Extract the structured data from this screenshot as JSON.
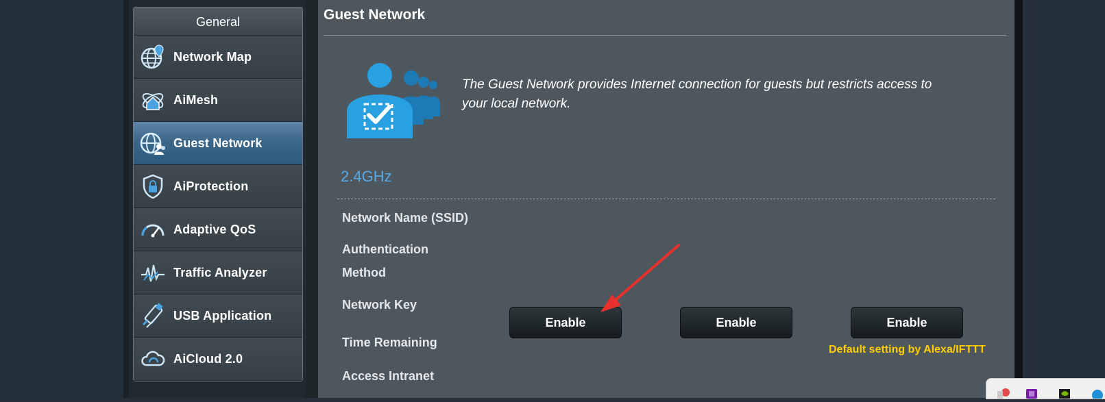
{
  "sidebar": {
    "header": "General",
    "items": [
      {
        "label": "Network Map",
        "icon": "network-map-icon",
        "active": false
      },
      {
        "label": "AiMesh",
        "icon": "aimesh-icon",
        "active": false
      },
      {
        "label": "Guest Network",
        "icon": "guest-network-icon",
        "active": true
      },
      {
        "label": "AiProtection",
        "icon": "aiprotection-icon",
        "active": false
      },
      {
        "label": "Adaptive QoS",
        "icon": "adaptive-qos-icon",
        "active": false
      },
      {
        "label": "Traffic Analyzer",
        "icon": "traffic-analyzer-icon",
        "active": false
      },
      {
        "label": "USB Application",
        "icon": "usb-application-icon",
        "active": false
      },
      {
        "label": "AiCloud 2.0",
        "icon": "aicloud-icon",
        "active": false
      }
    ]
  },
  "main": {
    "title": "Guest Network",
    "description": "The Guest Network provides Internet connection for guests but restricts access to your local network.",
    "band": "2.4GHz",
    "rows": {
      "ssid": "Network Name (SSID)",
      "auth_line1": "Authentication",
      "auth_line2": "Method",
      "key": "Network Key",
      "time": "Time Remaining",
      "intranet": "Access Intranet"
    },
    "buttons": [
      "Enable",
      "Enable",
      "Enable"
    ],
    "note": "Default setting by Alexa/IFTTT"
  },
  "colors": {
    "accent_blue": "#58a8e4",
    "note_yellow": "#ffcc00",
    "annotation_red": "#e8312f"
  }
}
